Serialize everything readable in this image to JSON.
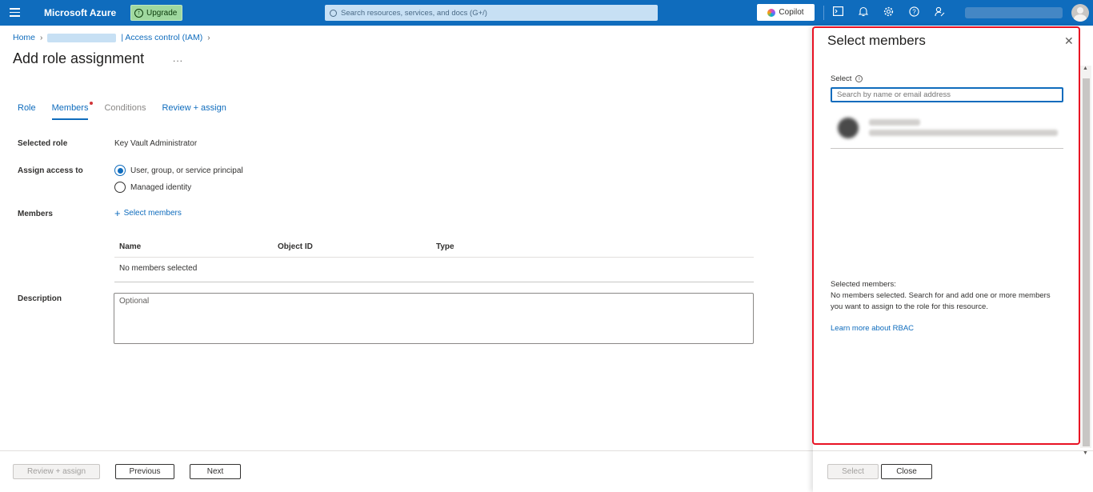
{
  "topbar": {
    "brand": "Microsoft Azure",
    "upgrade_label": "Upgrade",
    "search_placeholder": "Search resources, services, and docs (G+/)",
    "copilot_label": "Copilot",
    "icons": [
      "cloud-shell-icon",
      "bell-icon",
      "gear-icon",
      "help-icon",
      "feedback-icon"
    ]
  },
  "breadcrumb": {
    "home": "Home",
    "current": "| Access control (IAM)"
  },
  "page": {
    "title": "Add role assignment",
    "more": "..."
  },
  "tabs": [
    {
      "label": "Role",
      "state": "normal"
    },
    {
      "label": "Members",
      "state": "active"
    },
    {
      "label": "Conditions",
      "state": "disabled"
    },
    {
      "label": "Review + assign",
      "state": "normal"
    }
  ],
  "form": {
    "selected_role_label": "Selected role",
    "selected_role_value": "Key Vault Administrator",
    "assign_access_label": "Assign access to",
    "assign_options": [
      {
        "label": "User, group, or service principal",
        "checked": true
      },
      {
        "label": "Managed identity",
        "checked": false
      }
    ],
    "members_label": "Members",
    "select_members_link": "Select members",
    "table_headers": [
      "Name",
      "Object ID",
      "Type"
    ],
    "table_empty": "No members selected",
    "description_label": "Description",
    "description_placeholder": "Optional"
  },
  "footer": {
    "review_assign": "Review + assign",
    "previous": "Previous",
    "next": "Next"
  },
  "panel": {
    "title": "Select members",
    "select_label": "Select",
    "search_placeholder": "Search by name or email address",
    "selected_members_heading": "Selected members:",
    "selected_members_text": "No members selected. Search for and add one or more members you want to assign to the role for this resource.",
    "learn_more": "Learn more about RBAC",
    "select_button": "Select",
    "close_button": "Close"
  },
  "colors": {
    "topbar": "#0f6cbd",
    "accent": "#0f6cbd",
    "highlight_border": "#e81123",
    "required_dot": "#d13438"
  }
}
